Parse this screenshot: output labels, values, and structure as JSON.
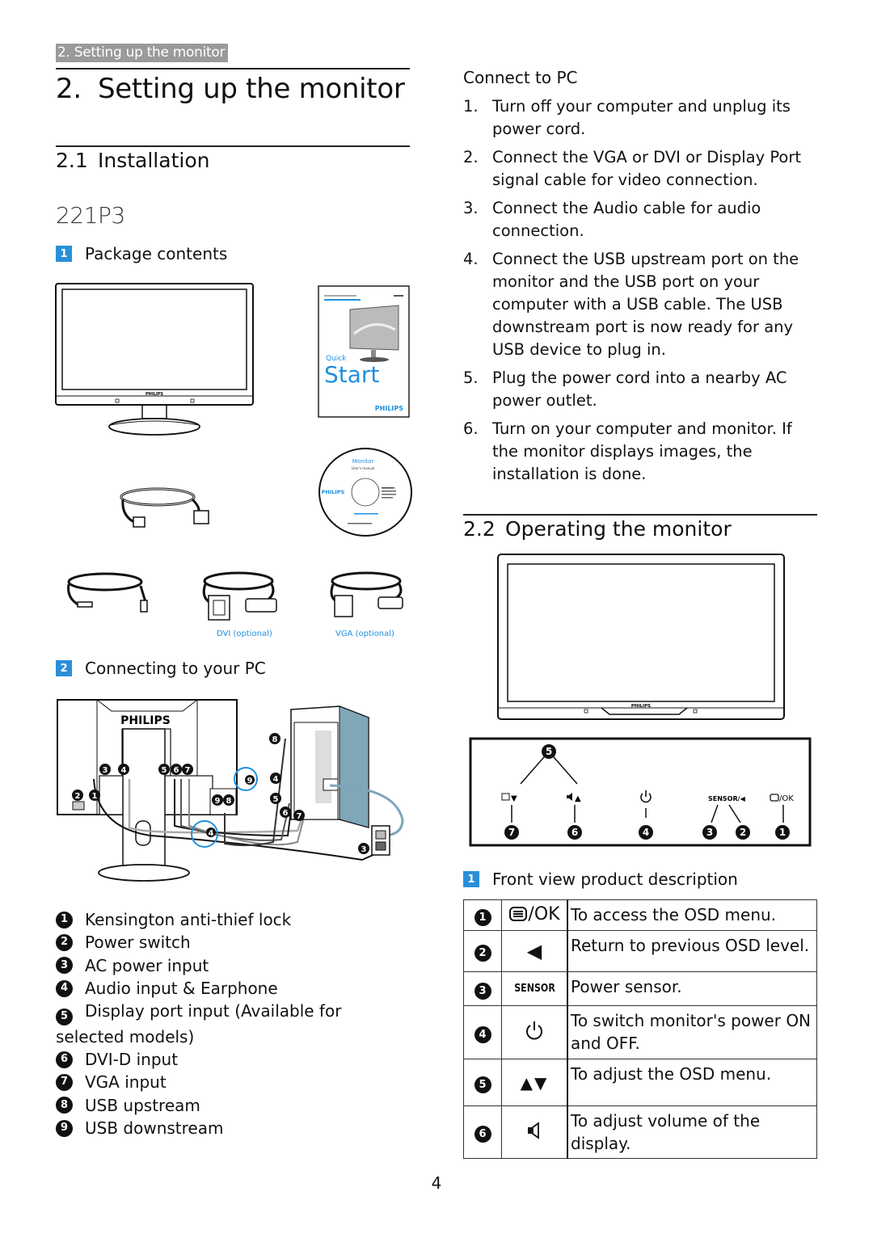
{
  "running_head": "2. Setting up the monitor",
  "chapter": {
    "number": "2.",
    "title": "Setting up the monitor"
  },
  "section_install": {
    "number": "2.1",
    "title": "Installation"
  },
  "model": "221P3",
  "package": {
    "badge": "1",
    "title": "Package contents",
    "quick_start": {
      "small": "Quick",
      "big": "Start",
      "brand": "PHILIPS"
    },
    "cd": {
      "title": "Monitor",
      "subtitle": "User's manual",
      "brand": "PHILIPS"
    },
    "monitor_brand": "PHILIPS",
    "cable_labels": {
      "dvi": "DVI  (optional)",
      "vga": "VGA (optional)"
    }
  },
  "connecting": {
    "badge": "2",
    "title": "Connecting to your PC",
    "diagram_brand": "PHILIPS",
    "legend": [
      {
        "num": "1",
        "label": "Kensington anti-thief lock"
      },
      {
        "num": "2",
        "label": "Power switch"
      },
      {
        "num": "3",
        "label": "AC power input"
      },
      {
        "num": "4",
        "label": "Audio input & Earphone"
      },
      {
        "num": "5",
        "label": "Display port input (Available for selected models)"
      },
      {
        "num": "6",
        "label": "DVI-D input"
      },
      {
        "num": "7",
        "label": "VGA input"
      },
      {
        "num": "8",
        "label": "USB upstream"
      },
      {
        "num": "9",
        "label": "USB downstream"
      }
    ]
  },
  "connect_to_pc": {
    "title": "Connect to PC",
    "steps": [
      {
        "n": "1.",
        "text": "Turn off your computer and unplug its power cord."
      },
      {
        "n": "2.",
        "text": "Connect the VGA or DVI or Display Port signal cable for video connection."
      },
      {
        "n": "3.",
        "text": "Connect the Audio cable for audio connection."
      },
      {
        "n": "4.",
        "text": "Connect the USB upstream port on the monitor and the USB port on your computer with a USB cable. The USB downstream port is now ready for any USB  device to plug in."
      },
      {
        "n": "5.",
        "text": "Plug the power cord into a nearby AC power outlet."
      },
      {
        "n": "6.",
        "text": "Turn on your computer and monitor. If the monitor displays images, the installation is done."
      }
    ]
  },
  "section_operating": {
    "number": "2.2",
    "title": "Operating the monitor"
  },
  "front_panel": {
    "monitor_brand": "PHILIPS",
    "buttons": [
      {
        "label": "▼",
        "prefix_icon": "smartimage-icon",
        "callout": "7"
      },
      {
        "label": "▲",
        "prefix_icon": "speaker-icon",
        "callout": "6"
      },
      {
        "label": "",
        "prefix_icon": "power-icon",
        "callout": "4"
      },
      {
        "label": "SENSOR/◀",
        "prefix_icon": "",
        "callout": "3,2"
      },
      {
        "label": "/OK",
        "prefix_icon": "menu-icon",
        "callout": "1"
      }
    ],
    "group_callout": "5"
  },
  "front_view": {
    "badge": "1",
    "title": "Front view product description",
    "rows": [
      {
        "num": "1",
        "key": "/OK",
        "icon": "menu-icon",
        "desc": "To access the OSD menu."
      },
      {
        "num": "2",
        "key": "◀",
        "icon": "left-triangle-icon",
        "desc": "Return to previous OSD level."
      },
      {
        "num": "3",
        "key": "SENSOR",
        "icon": "",
        "desc": "Power sensor."
      },
      {
        "num": "4",
        "key": "",
        "icon": "power-icon",
        "desc": "To switch monitor's power ON and OFF."
      },
      {
        "num": "5",
        "key": "▲▼",
        "icon": "up-down-icon",
        "desc": "To adjust the OSD menu."
      },
      {
        "num": "6",
        "key": "",
        "icon": "speaker-icon",
        "desc": "To adjust volume of the display."
      }
    ]
  },
  "page_number": "4"
}
